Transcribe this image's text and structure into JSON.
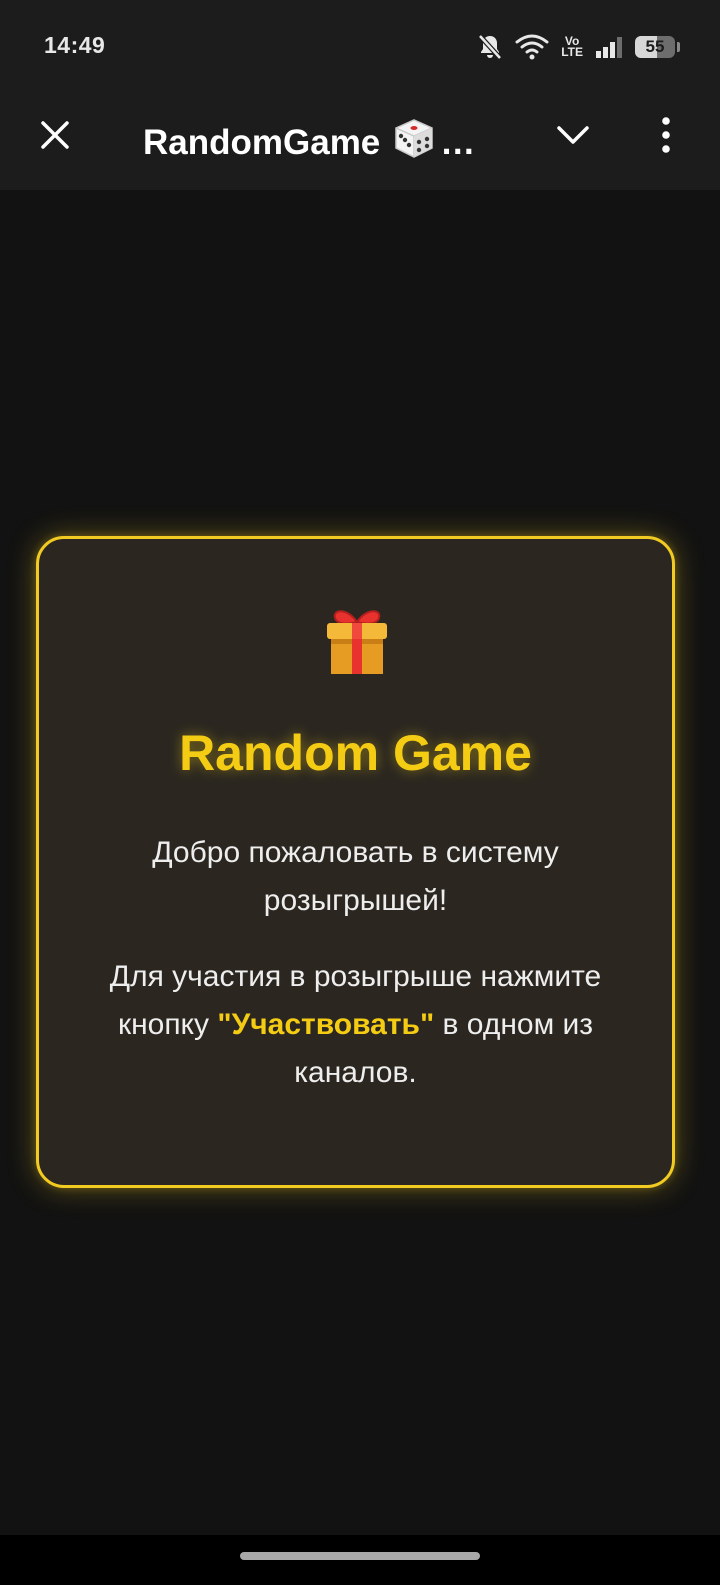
{
  "status_bar": {
    "time": "14:49",
    "icons": [
      "bell-muted-icon",
      "wifi-icon",
      "volte-icon",
      "signal-icon",
      "battery-icon"
    ],
    "volte_top": "Vo",
    "volte_bottom": "LTE",
    "battery_level": "55",
    "battery_fraction": 0.55
  },
  "header": {
    "title": "RandomGame",
    "title_emoji": "dice-icon",
    "ellipsis": "…",
    "close_icon": "close-icon",
    "collapse_icon": "chevron-down-icon",
    "menu_icon": "more-vertical-icon"
  },
  "card": {
    "icon": "gift-icon",
    "title": "Random Game",
    "welcome_text": "Добро пожаловать в систему розыгрышей!",
    "instruction_before": "Для участия в розыгрыше нажмите кнопку ",
    "instruction_highlight": "\"Участвовать\"",
    "instruction_after": " в одном из каналов."
  },
  "colors": {
    "accent": "#f5cc14",
    "background": "#121212",
    "header": "#1c1c1c",
    "card_background": "#2b2720"
  }
}
